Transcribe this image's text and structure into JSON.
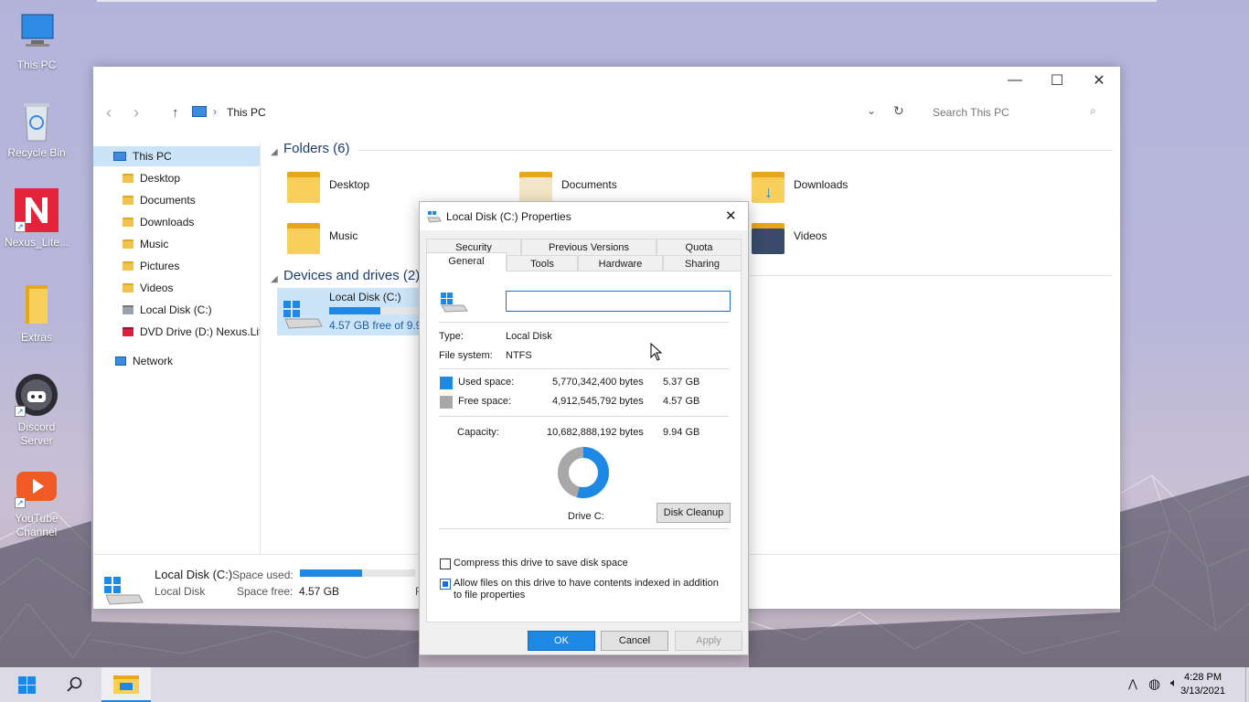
{
  "desktop": {
    "icons": [
      {
        "label": "This PC"
      },
      {
        "label": "Recycle Bin"
      },
      {
        "label": "Nexus_Lite..."
      },
      {
        "label": "Extras"
      },
      {
        "label": "Discord Server"
      },
      {
        "label": "YouTube Channel"
      }
    ]
  },
  "explorer": {
    "address": "This PC",
    "search_placeholder": "Search This PC",
    "sidebar": [
      "This PC",
      "Desktop",
      "Documents",
      "Downloads",
      "Music",
      "Pictures",
      "Videos",
      "Local Disk (C:)",
      "DVD Drive (D:) Nexus.Lite",
      "Network"
    ],
    "folders_title": "Folders (6)",
    "folders": [
      "Desktop",
      "Documents",
      "Downloads",
      "Music",
      "Videos"
    ],
    "devices_title": "Devices and drives (2)",
    "drive": {
      "name": "Local Disk (C:)",
      "free_text": "4.57 GB free of 9.94",
      "used_fraction": 0.54
    },
    "status": {
      "name": "Local Disk (C:)",
      "type": "Local Disk",
      "space_used_label": "Space used:",
      "space_free_label": "Space free:",
      "space_free_value": "4.57 GB",
      "trailing": "F"
    }
  },
  "dialog": {
    "title": "Local Disk (C:) Properties",
    "tabs_back": [
      "Security",
      "Previous Versions",
      "Quota"
    ],
    "tabs_front": [
      "General",
      "Tools",
      "Hardware",
      "Sharing"
    ],
    "name_value": "",
    "type_label": "Type:",
    "type_value": "Local Disk",
    "fs_label": "File system:",
    "fs_value": "NTFS",
    "used_label": "Used space:",
    "used_bytes": "5,770,342,400 bytes",
    "used_gb": "5.37 GB",
    "free_label": "Free space:",
    "free_bytes": "4,912,545,792 bytes",
    "free_gb": "4.57 GB",
    "capacity_label": "Capacity:",
    "capacity_bytes": "10,682,888,192 bytes",
    "capacity_gb": "9.94 GB",
    "drive_label": "Drive C:",
    "disk_cleanup": "Disk Cleanup",
    "compress_label": "Compress this drive to save disk space",
    "index_label": "Allow files on this drive to have contents indexed in addition to file properties",
    "compress_checked": false,
    "index_checked": true,
    "ok": "OK",
    "cancel": "Cancel",
    "apply": "Apply",
    "used_color": "#1e88e5",
    "free_color": "#a8a8a8"
  },
  "taskbar": {
    "time": "4:28 PM",
    "date": "3/13/2021"
  }
}
